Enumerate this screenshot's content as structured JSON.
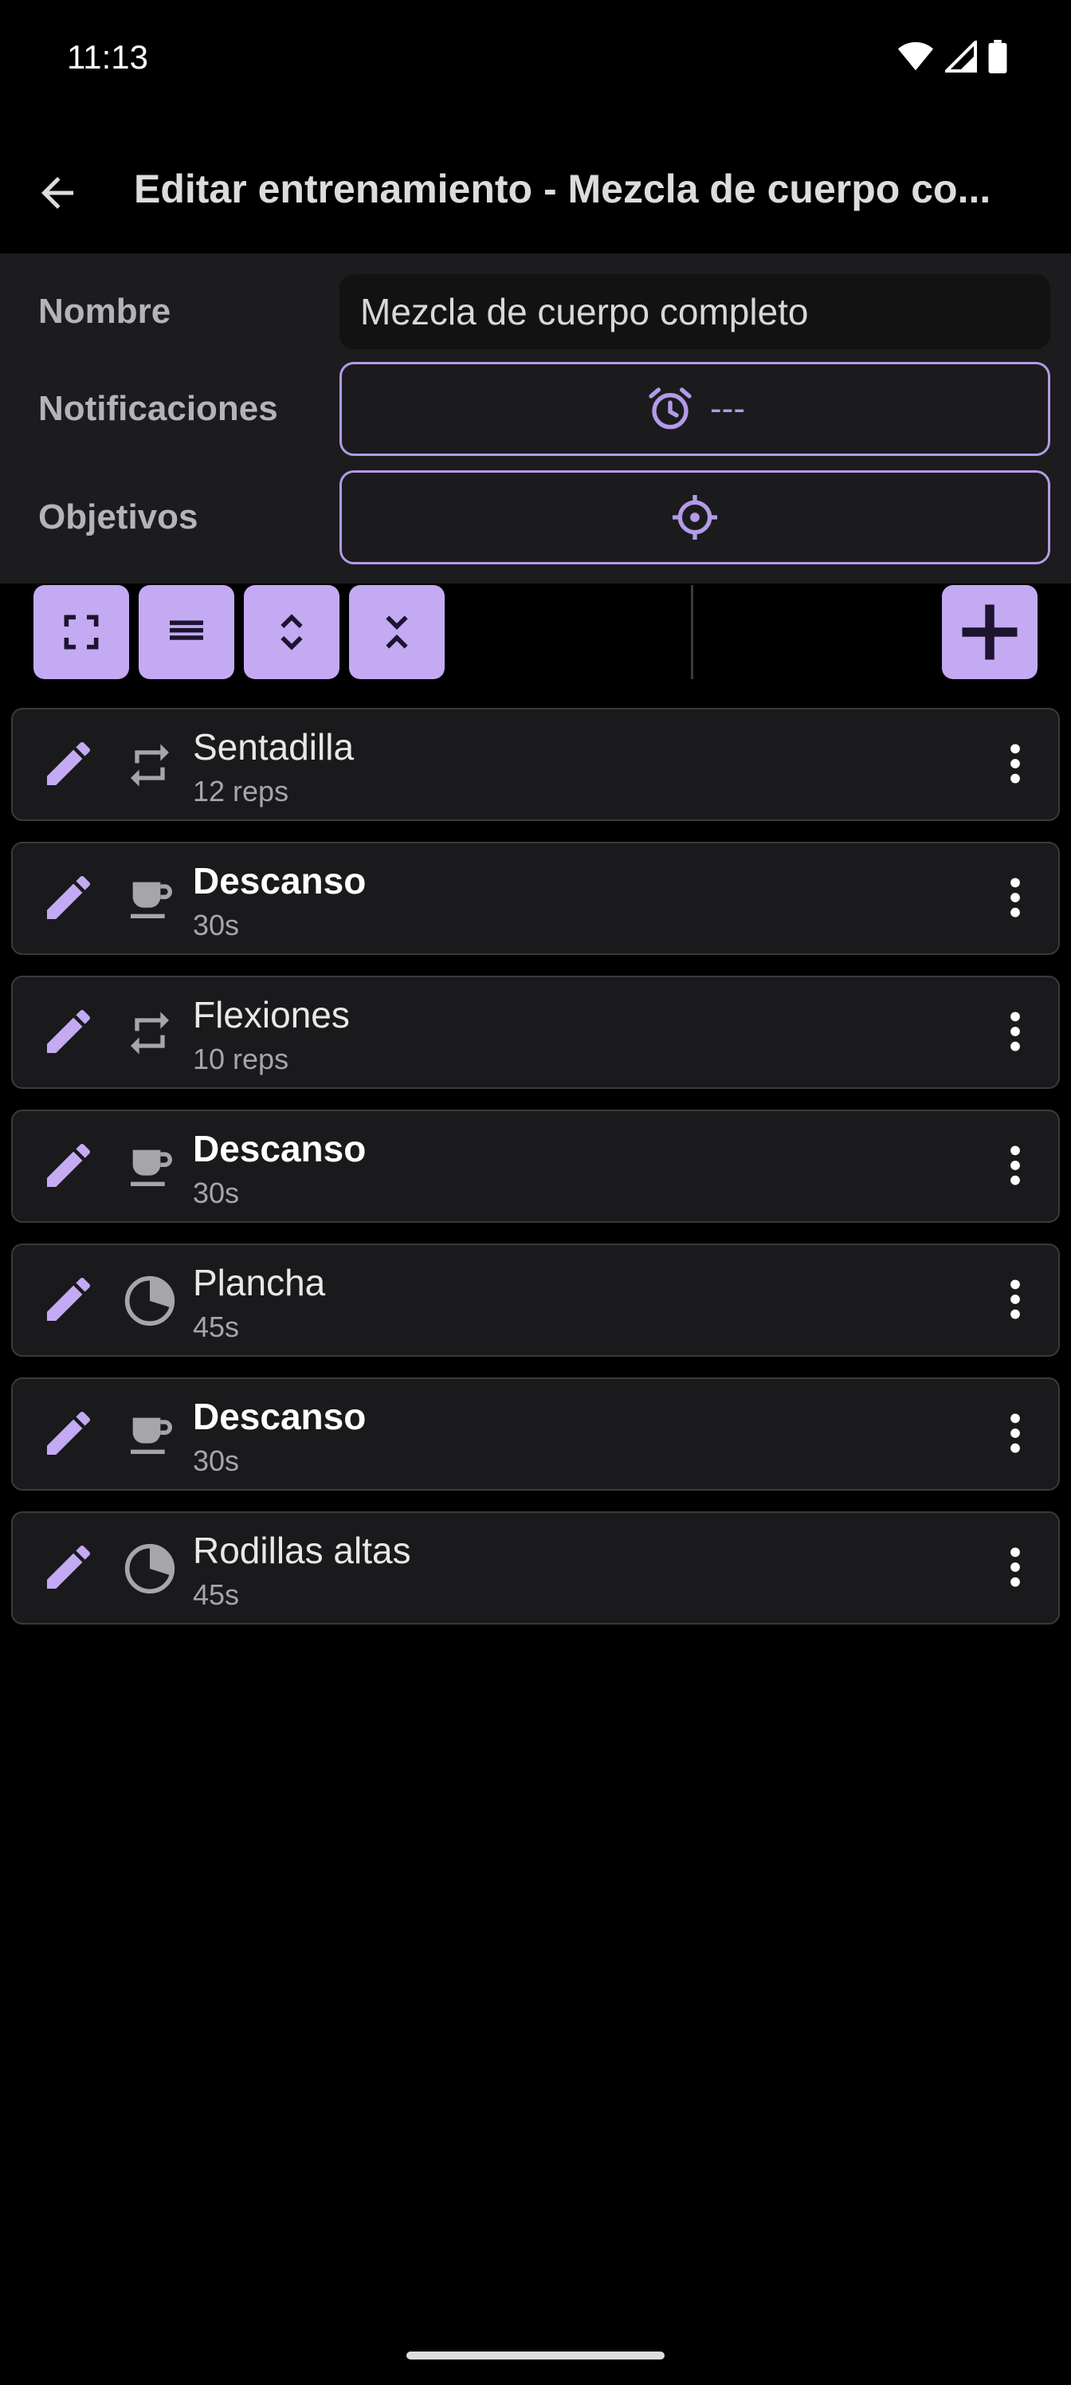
{
  "status_bar": {
    "time": "11:13"
  },
  "app_bar": {
    "title": "Editar entrenamiento - Mezcla de cuerpo co..."
  },
  "form": {
    "name_label": "Nombre",
    "name_value": "Mezcla de cuerpo completo",
    "notifications_label": "Notificaciones",
    "notifications_value": "---",
    "goals_label": "Objetivos"
  },
  "toolbar": {
    "buttons": [
      "expand-icon",
      "list-icon",
      "expand-all-icon",
      "collapse-all-icon"
    ],
    "add": "plus-icon"
  },
  "items": [
    {
      "name": "Sentadilla",
      "detail": "12 reps",
      "type": "repeat-icon",
      "bold": false
    },
    {
      "name": "Descanso",
      "detail": "30s",
      "type": "cup-icon",
      "bold": true
    },
    {
      "name": "Flexiones",
      "detail": "10 reps",
      "type": "repeat-icon",
      "bold": false
    },
    {
      "name": "Descanso",
      "detail": "30s",
      "type": "cup-icon",
      "bold": true
    },
    {
      "name": "Plancha",
      "detail": "45s",
      "type": "timer-pie-icon",
      "bold": false
    },
    {
      "name": "Descanso",
      "detail": "30s",
      "type": "cup-icon",
      "bold": true
    },
    {
      "name": "Rodillas altas",
      "detail": "45s",
      "type": "timer-pie-icon",
      "bold": false
    }
  ],
  "colors": {
    "accent": "#c4aaf3",
    "accent_outline": "#b49ae8",
    "background": "#000000",
    "panel": "#1c1c1e"
  }
}
